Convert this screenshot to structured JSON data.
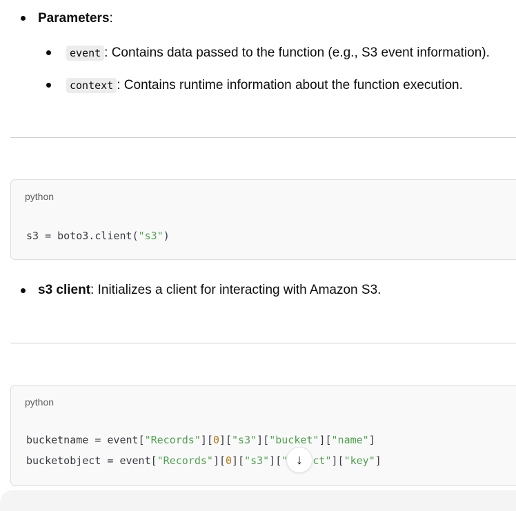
{
  "params": {
    "title": "Parameters",
    "colon": ":",
    "items": [
      {
        "code": "event",
        "text": ": Contains data passed to the function (e.g., S3 event information)."
      },
      {
        "code": "context",
        "text": ": Contains runtime information about the function execution."
      }
    ]
  },
  "block1": {
    "lang": "python",
    "code": {
      "a": "s3 = boto3.client(",
      "b": "\"s3\"",
      "c": ")"
    }
  },
  "s3client": {
    "title": "s3 client",
    "text": ": Initializes a client for interacting with Amazon S3."
  },
  "block2": {
    "lang": "python",
    "l1": {
      "a": "bucketname = event[",
      "b": "\"Records\"",
      "c": "][",
      "d": "0",
      "e": "][",
      "f": "\"s3\"",
      "g": "][",
      "h": "\"bucket\"",
      "i": "][",
      "j": "\"name\"",
      "k": "]"
    },
    "l2": {
      "a": "bucketobject = event[",
      "b": "\"Records\"",
      "c": "][",
      "d": "0",
      "e": "][",
      "f": "\"s3\"",
      "g": "][",
      "h": "\"object\"",
      "i": "][",
      "j": "\"key\"",
      "k": "]"
    }
  },
  "scroll_icon": "arrow-down-icon"
}
